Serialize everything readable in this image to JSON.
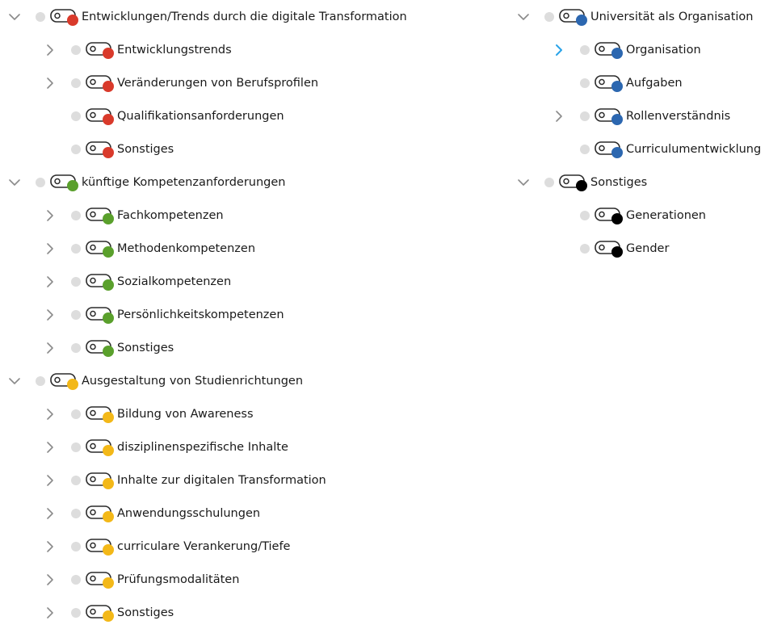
{
  "colors": {
    "red": "#d93a2b",
    "green": "#5aa02c",
    "yellow": "#f3b818",
    "blue": "#2c67b0",
    "black": "#000000",
    "chevron_gray": "#8a8a8a",
    "chevron_active": "#29a3e8",
    "dot_gray": "#dddddd"
  },
  "left_tree": [
    {
      "label": "Entwicklungen/Trends durch die digitale Transformation",
      "level": 0,
      "chevron": "down",
      "color": "red"
    },
    {
      "label": "Entwicklungstrends",
      "level": 1,
      "chevron": "right",
      "color": "red"
    },
    {
      "label": "Veränderungen von Berufsprofilen",
      "level": 1,
      "chevron": "right",
      "color": "red"
    },
    {
      "label": "Qualifikationsanforderungen",
      "level": 1,
      "chevron": "none",
      "color": "red"
    },
    {
      "label": "Sonstiges",
      "level": 1,
      "chevron": "none",
      "color": "red"
    },
    {
      "label": "künftige Kompetenzanforderungen",
      "level": 0,
      "chevron": "down",
      "color": "green"
    },
    {
      "label": "Fachkompetenzen",
      "level": 1,
      "chevron": "right",
      "color": "green"
    },
    {
      "label": "Methodenkompetenzen",
      "level": 1,
      "chevron": "right",
      "color": "green"
    },
    {
      "label": "Sozialkompetenzen",
      "level": 1,
      "chevron": "right",
      "color": "green"
    },
    {
      "label": "Persönlichkeitskompetenzen",
      "level": 1,
      "chevron": "right",
      "color": "green"
    },
    {
      "label": "Sonstiges",
      "level": 1,
      "chevron": "right",
      "color": "green"
    },
    {
      "label": "Ausgestaltung von Studienrichtungen",
      "level": 0,
      "chevron": "down",
      "color": "yellow"
    },
    {
      "label": "Bildung von Awareness",
      "level": 1,
      "chevron": "right",
      "color": "yellow"
    },
    {
      "label": "disziplinenspezifische Inhalte",
      "level": 1,
      "chevron": "right",
      "color": "yellow"
    },
    {
      "label": "Inhalte zur digitalen Transformation",
      "level": 1,
      "chevron": "right",
      "color": "yellow"
    },
    {
      "label": "Anwendungsschulungen",
      "level": 1,
      "chevron": "right",
      "color": "yellow"
    },
    {
      "label": "curriculare Verankerung/Tiefe",
      "level": 1,
      "chevron": "right",
      "color": "yellow"
    },
    {
      "label": "Prüfungsmodalitäten",
      "level": 1,
      "chevron": "right",
      "color": "yellow"
    },
    {
      "label": "Sonstiges",
      "level": 1,
      "chevron": "right",
      "color": "yellow"
    }
  ],
  "right_tree": [
    {
      "label": "Universität als Organisation",
      "level": 0,
      "chevron": "down",
      "color": "blue"
    },
    {
      "label": "Organisation",
      "level": 1,
      "chevron": "right-active",
      "color": "blue"
    },
    {
      "label": "Aufgaben",
      "level": 1,
      "chevron": "none",
      "color": "blue"
    },
    {
      "label": "Rollenverständnis",
      "level": 1,
      "chevron": "right",
      "color": "blue"
    },
    {
      "label": "Curriculumentwicklung",
      "level": 1,
      "chevron": "none",
      "color": "blue"
    },
    {
      "label": "Sonstiges",
      "level": 0,
      "chevron": "down",
      "color": "black"
    },
    {
      "label": "Generationen",
      "level": 1,
      "chevron": "none",
      "color": "black"
    },
    {
      "label": "Gender",
      "level": 1,
      "chevron": "none",
      "color": "black"
    }
  ]
}
